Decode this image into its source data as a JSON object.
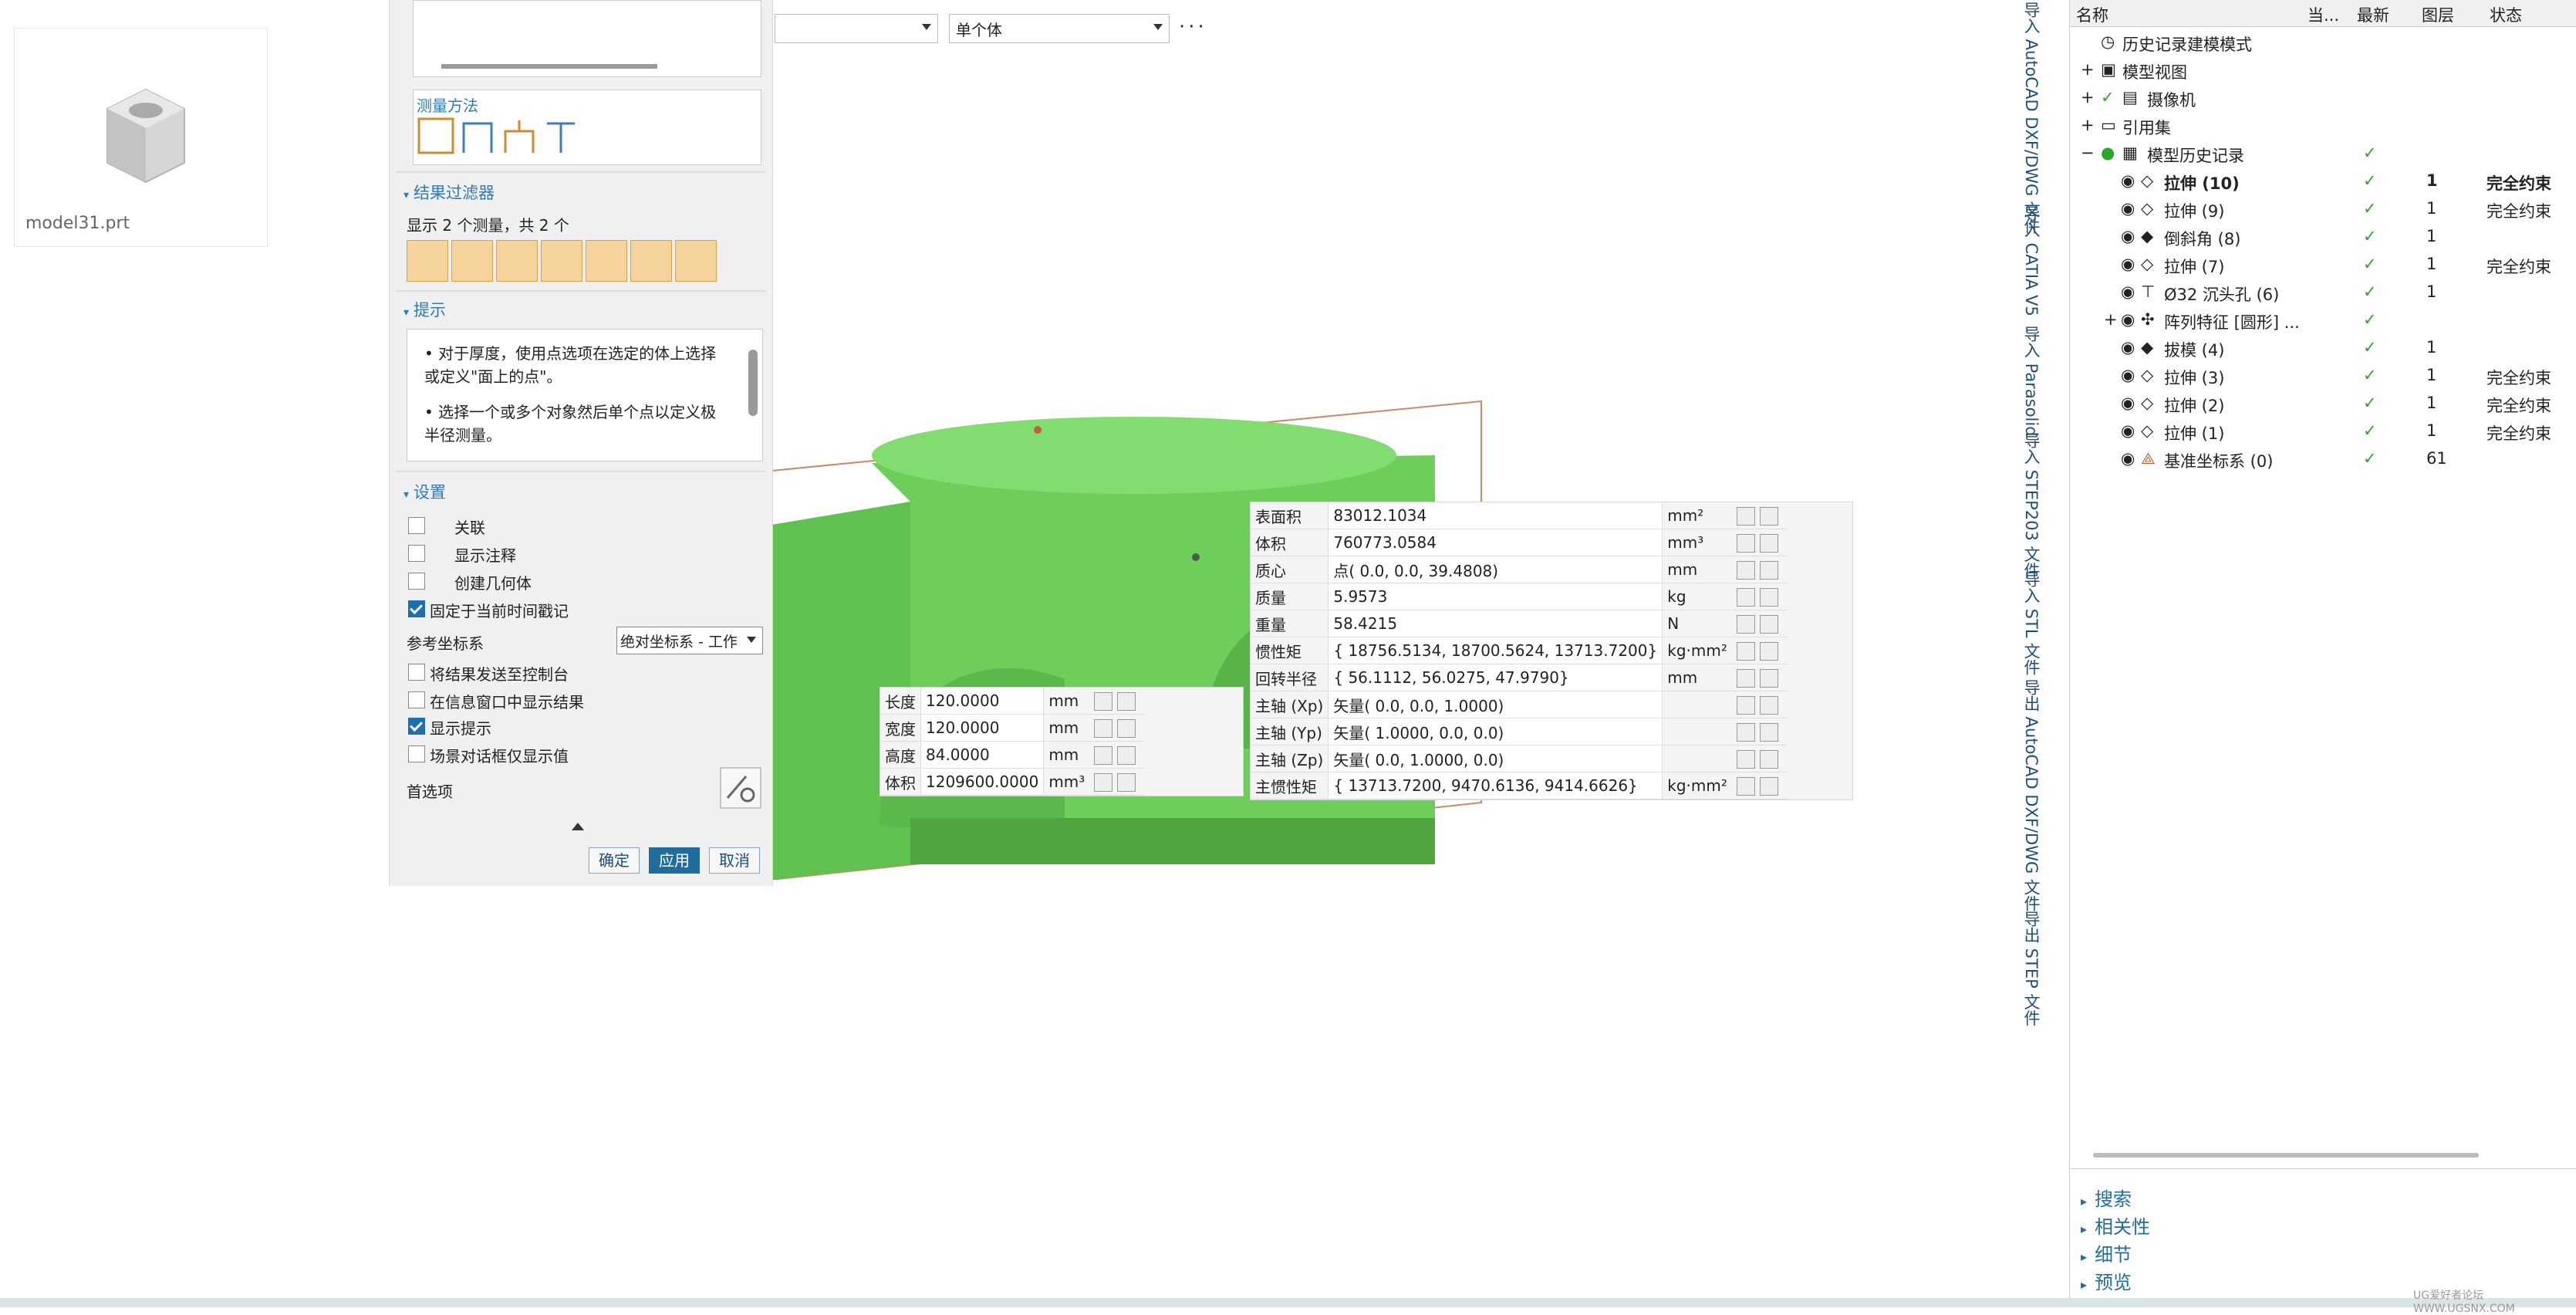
{
  "file": {
    "name": "model31.prt"
  },
  "dialog": {
    "measure_method_label": "测量方法",
    "result_filter": {
      "title": "结果过滤器",
      "summary": "显示 2 个测量，共 2 个"
    },
    "hints": {
      "title": "提示",
      "hint1": "对于厚度，使用点选项在选定的体上选择或定义\"面上的点\"。",
      "hint2": "选择一个或多个对象然后单个点以定义极半径测量。"
    },
    "settings": {
      "title": "设置",
      "associative": "关联",
      "show_annotation": "显示注释",
      "create_geometry": "创建几何体",
      "fix_timestamp": "固定于当前时间戳记",
      "ref_csys_label": "参考坐标系",
      "ref_csys_value": "绝对坐标系 - 工作",
      "send_console": "将结果发送至控制台",
      "show_info_window": "在信息窗口中显示结果",
      "show_hints": "显示提示",
      "scene_only": "场景对话框仅显示值",
      "preferences": "首选项"
    },
    "buttons": {
      "ok": "确定",
      "apply": "应用",
      "cancel": "取消"
    }
  },
  "toolbar": {
    "filter1": "",
    "filter2": "单个体",
    "more": "···"
  },
  "bbox_table": [
    {
      "label": "长度",
      "value": "120.0000",
      "unit": "mm"
    },
    {
      "label": "宽度",
      "value": "120.0000",
      "unit": "mm"
    },
    {
      "label": "高度",
      "value": "84.0000",
      "unit": "mm"
    },
    {
      "label": "体积",
      "value": "1209600.0000",
      "unit": "mm³"
    }
  ],
  "mass_table": [
    {
      "label": "表面积",
      "value": "83012.1034",
      "unit": "mm²"
    },
    {
      "label": "体积",
      "value": "760773.0584",
      "unit": "mm³"
    },
    {
      "label": "质心",
      "value": "点( 0.0, 0.0, 39.4808)",
      "unit": "mm"
    },
    {
      "label": "质量",
      "value": "5.9573",
      "unit": "kg"
    },
    {
      "label": "重量",
      "value": "58.4215",
      "unit": "N"
    },
    {
      "label": "惯性矩",
      "value": "{ 18756.5134, 18700.5624, 13713.7200}",
      "unit": "kg·mm²"
    },
    {
      "label": "回转半径",
      "value": "{ 56.1112, 56.0275, 47.9790}",
      "unit": "mm"
    },
    {
      "label": "主轴 (Xp)",
      "value": "矢量( 0.0, 0.0, 1.0000)",
      "unit": ""
    },
    {
      "label": "主轴 (Yp)",
      "value": "矢量( 1.0000, 0.0, 0.0)",
      "unit": ""
    },
    {
      "label": "主轴 (Zp)",
      "value": "矢量( 0.0, 1.0000, 0.0)",
      "unit": ""
    },
    {
      "label": "主惯性矩",
      "value": "{ 13713.7200, 9470.6136, 9414.6626}",
      "unit": "kg·mm²"
    }
  ],
  "side_strip": [
    "导入 AutoCAD DXF/DWG 文件",
    "导入 CATIA V5",
    "导入 Parasolid",
    "导入 STEP203 文件",
    "导入 STL 文件",
    "导出 AutoCAD DXF/DWG 文件",
    "导出 STEP 文件"
  ],
  "navigator": {
    "columns": {
      "name": "名称",
      "current": "当...",
      "latest": "最新",
      "layer": "图层",
      "status": "状态"
    },
    "rows": [
      {
        "name": "历史记录建模模式",
        "layer": "",
        "status": ""
      },
      {
        "name": "模型视图",
        "layer": "",
        "status": ""
      },
      {
        "name": "摄像机",
        "layer": "",
        "status": ""
      },
      {
        "name": "引用集",
        "layer": "",
        "status": ""
      },
      {
        "name": "模型历史记录",
        "layer": "",
        "status": ""
      },
      {
        "name": "拉伸 (10)",
        "layer": "1",
        "status": "完全约束"
      },
      {
        "name": "拉伸 (9)",
        "layer": "1",
        "status": "完全约束"
      },
      {
        "name": "倒斜角 (8)",
        "layer": "1",
        "status": ""
      },
      {
        "name": "拉伸 (7)",
        "layer": "1",
        "status": "完全约束"
      },
      {
        "name": "Ø32 沉头孔 (6)",
        "layer": "1",
        "status": ""
      },
      {
        "name": "阵列特征 [圆形] ...",
        "layer": "",
        "status": ""
      },
      {
        "name": "拔模 (4)",
        "layer": "1",
        "status": ""
      },
      {
        "name": "拉伸 (3)",
        "layer": "1",
        "status": "完全约束"
      },
      {
        "name": "拉伸 (2)",
        "layer": "1",
        "status": "完全约束"
      },
      {
        "name": "拉伸 (1)",
        "layer": "1",
        "status": "完全约束"
      },
      {
        "name": "基准坐标系 (0)",
        "layer": "61",
        "status": ""
      }
    ],
    "bottom": [
      "搜索",
      "相关性",
      "细节",
      "预览"
    ]
  },
  "watermark": "UG爱好者论坛 WWW.UGSNX.COM",
  "colors": {
    "model": "#6dcf5a",
    "accent": "#2f7bb8",
    "check": "#2aa82a"
  }
}
